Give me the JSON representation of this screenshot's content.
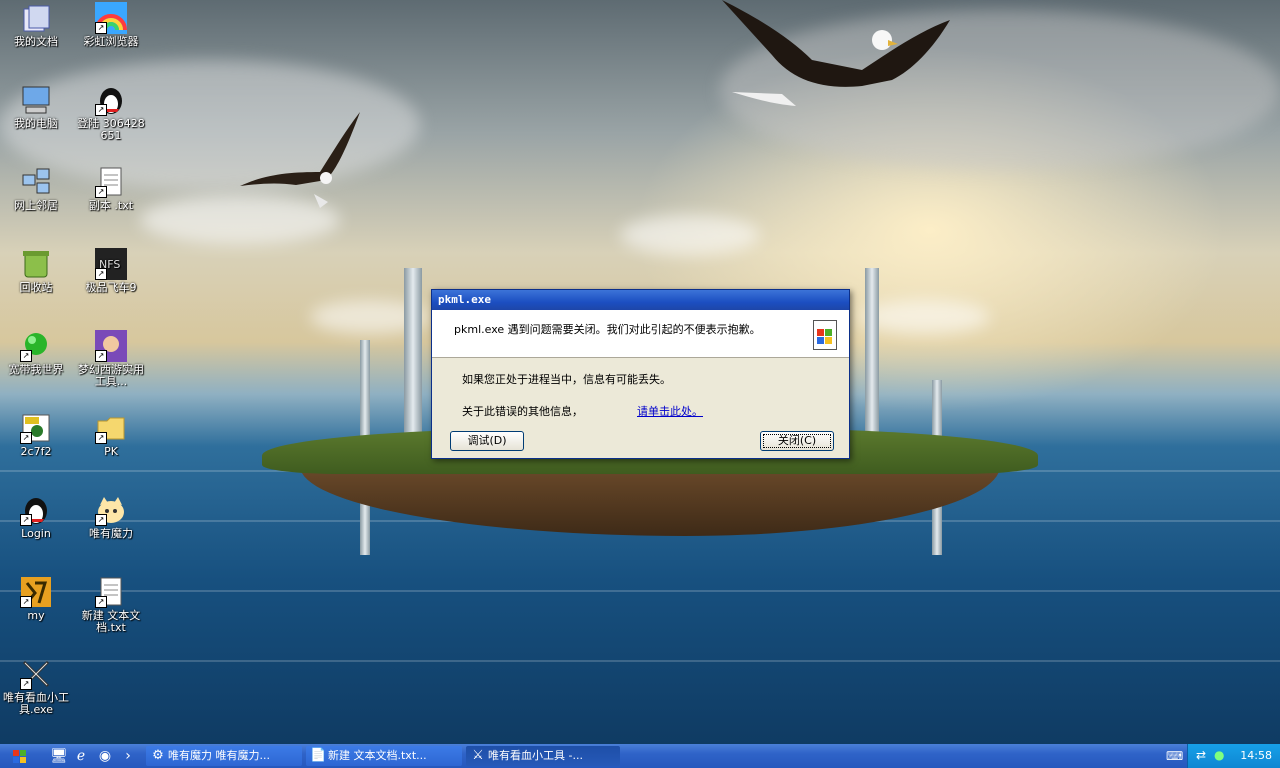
{
  "desktop_icons": [
    {
      "label": "我的文档",
      "icon": "my-documents-icon"
    },
    {
      "label": "彩虹浏览器",
      "icon": "rainbow-browser-icon"
    },
    {
      "label": "我的电脑",
      "icon": "my-computer-icon"
    },
    {
      "label": "登陆 306428651",
      "icon": "qq-penguin-icon"
    },
    {
      "label": "网上邻居",
      "icon": "network-places-icon"
    },
    {
      "label": "副本 .txt",
      "icon": "text-file-icon"
    },
    {
      "label": "回收站",
      "icon": "recycle-bin-icon"
    },
    {
      "label": "极品飞车9",
      "icon": "nfs-game-icon"
    },
    {
      "label": "宽带我世界",
      "icon": "broadband-icon"
    },
    {
      "label": "梦幻西游实用工具...",
      "icon": "game-character-icon"
    },
    {
      "label": "2c7f2",
      "icon": "jpg-image-icon"
    },
    {
      "label": "PK",
      "icon": "folder-icon"
    },
    {
      "label": "Login",
      "icon": "qq-penguin-icon"
    },
    {
      "label": "唯有魔力",
      "icon": "cat-icon"
    },
    {
      "label": "my",
      "icon": "game-icon"
    },
    {
      "label": "新建 文本文档.txt",
      "icon": "text-file-icon"
    },
    {
      "label": "唯有看血小工具.exe",
      "icon": "crossed-swords-icon"
    }
  ],
  "dialog": {
    "title": "pkml.exe",
    "message": "pkml.exe 遇到问题需要关闭。我们对此引起的不便表示抱歉。",
    "info_line": "如果您正处于进程当中，信息有可能丢失。",
    "more_info_label": "关于此错误的其他信息，",
    "more_info_link": "请单击此处。",
    "debug_button": "调试(D)",
    "close_button": "关闭(C)"
  },
  "taskbar": {
    "tasks": [
      {
        "label": "唯有魔力 唯有魔力...",
        "icon": "gear-app-icon"
      },
      {
        "label": "新建 文本文档.txt...",
        "icon": "notepad-icon"
      },
      {
        "label": "唯有看血小工具 -...",
        "icon": "crossed-swords-icon"
      }
    ],
    "clock": "14:58"
  },
  "colors": {
    "titlebar": "#1c4fc2",
    "taskbar": "#2f63c8",
    "tray": "#0e86d2",
    "dialog_bg": "#ece9d8",
    "link": "#0000cc"
  }
}
